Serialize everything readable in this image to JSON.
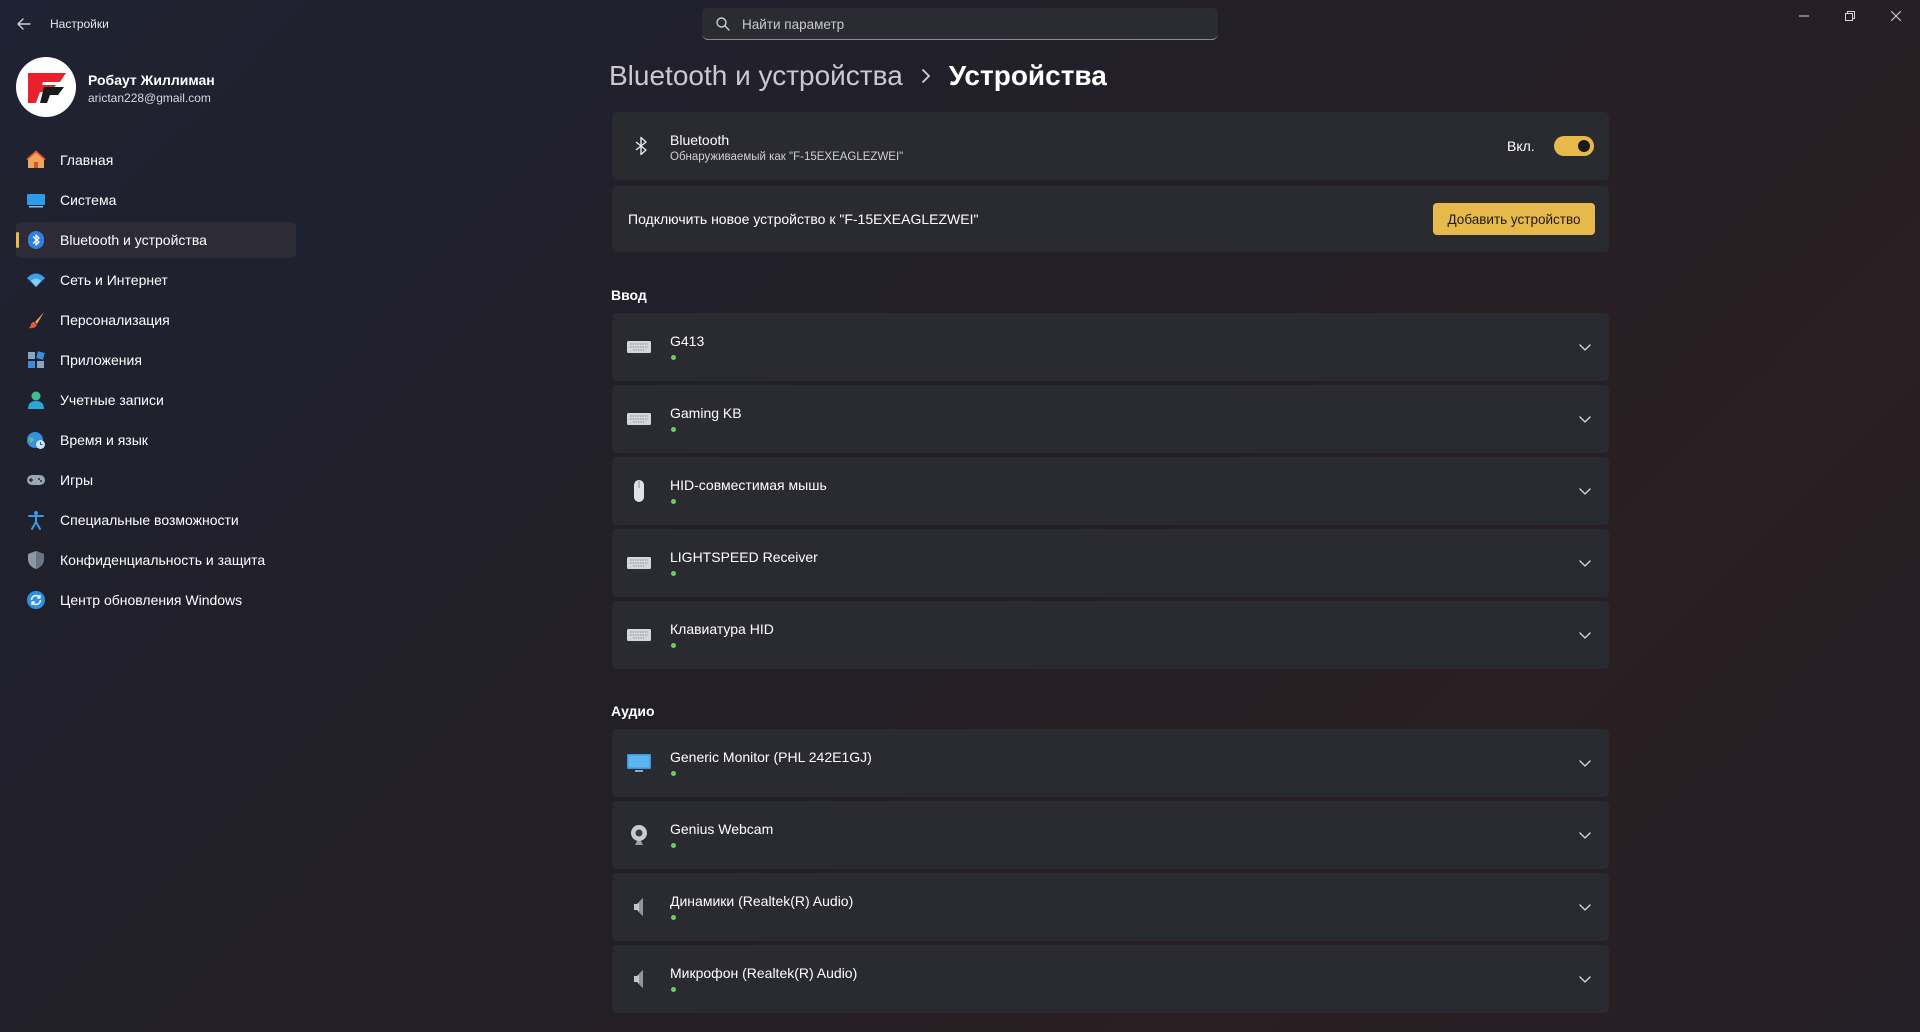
{
  "window": {
    "title": "Настройки",
    "search_placeholder": "Найти параметр"
  },
  "profile": {
    "name": "Робаут Жиллиман",
    "email": "arictan228@gmail.com"
  },
  "sidebar": {
    "items": [
      {
        "label": "Главная",
        "icon": "home-icon"
      },
      {
        "label": "Система",
        "icon": "system-icon"
      },
      {
        "label": "Bluetooth и устройства",
        "icon": "bluetooth-icon",
        "active": true
      },
      {
        "label": "Сеть и Интернет",
        "icon": "wifi-icon"
      },
      {
        "label": "Персонализация",
        "icon": "brush-icon"
      },
      {
        "label": "Приложения",
        "icon": "apps-icon"
      },
      {
        "label": "Учетные записи",
        "icon": "account-icon"
      },
      {
        "label": "Время и язык",
        "icon": "globe-clock-icon"
      },
      {
        "label": "Игры",
        "icon": "gamepad-icon"
      },
      {
        "label": "Специальные возможности",
        "icon": "accessibility-icon"
      },
      {
        "label": "Конфиденциальность и защита",
        "icon": "shield-icon"
      },
      {
        "label": "Центр обновления Windows",
        "icon": "update-icon"
      }
    ]
  },
  "breadcrumb": {
    "parent": "Bluetooth и устройства",
    "current": "Устройства"
  },
  "bluetooth": {
    "title": "Bluetooth",
    "subtitle": "Обнаруживаемый как \"F-15EXEAGLEZWEI\"",
    "toggle_label": "Вкл.",
    "on": true
  },
  "connect": {
    "text": "Подключить новое устройство к \"F-15EXEAGLEZWEI\"",
    "button_label": "Добавить устройство"
  },
  "colors": {
    "accent": "#e7b94a",
    "connected_dot": "#6ccb5f",
    "card_bg": "#2a2a31"
  },
  "sections": [
    {
      "title": "Ввод",
      "devices": [
        {
          "name": "G413",
          "icon": "keyboard-icon"
        },
        {
          "name": "Gaming KB",
          "icon": "keyboard-icon"
        },
        {
          "name": "HID-совместимая мышь",
          "icon": "mouse-icon"
        },
        {
          "name": "LIGHTSPEED Receiver",
          "icon": "keyboard-icon"
        },
        {
          "name": "Клавиатура HID",
          "icon": "keyboard-icon"
        }
      ]
    },
    {
      "title": "Аудио",
      "devices": [
        {
          "name": "Generic Monitor (PHL 242E1GJ)",
          "icon": "monitor-icon"
        },
        {
          "name": "Genius Webcam",
          "icon": "webcam-icon"
        },
        {
          "name": "Динамики (Realtek(R) Audio)",
          "icon": "speaker-icon"
        },
        {
          "name": "Микрофон (Realtek(R) Audio)",
          "icon": "speaker-icon"
        }
      ]
    }
  ]
}
